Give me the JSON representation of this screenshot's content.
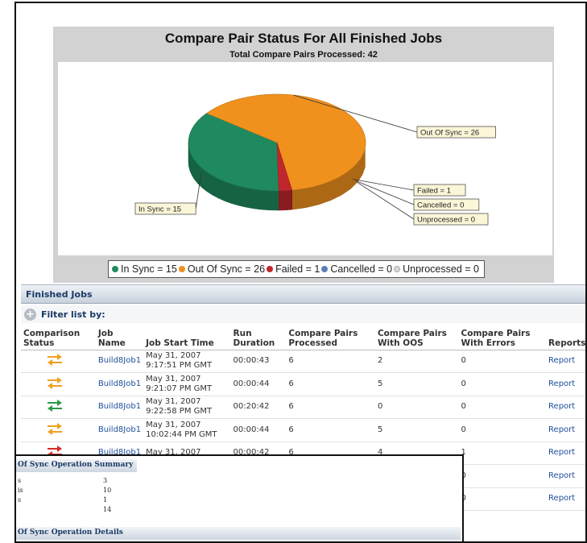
{
  "chart": {
    "title": "Compare Pair Status For All Finished Jobs",
    "subtitle": "Total Compare Pairs Processed: 42"
  },
  "chart_data": {
    "type": "pie",
    "title": "Compare Pair Status For All Finished Jobs",
    "subtitle": "Total Compare Pairs Processed: 42",
    "categories": [
      "In Sync",
      "Out Of Sync",
      "Failed",
      "Cancelled",
      "Unprocessed"
    ],
    "values": [
      15,
      26,
      1,
      0,
      0
    ],
    "colors": [
      "#1f8a5f",
      "#f0911e",
      "#c0272d",
      "#5b7fb5",
      "#d8d8d8"
    ],
    "slice_labels": [
      "In Sync = 15",
      "Out Of Sync = 26",
      "Failed = 1",
      "Cancelled = 0",
      "Unprocessed = 0"
    ],
    "legend": [
      "In Sync = 15",
      "Out Of Sync = 26",
      "Failed = 1",
      "Cancelled = 0",
      "Unprocessed = 0"
    ],
    "legend_position": "bottom",
    "style": "3d"
  },
  "finished_jobs": {
    "section_title": "Finished Jobs",
    "filter_label": "Filter list by:",
    "filter_icon": "add-filter-icon",
    "columns": [
      "Comparison Status",
      "Job Name",
      "Job Start Time",
      "Run Duration",
      "Compare Pairs Processed",
      "Compare Pairs With OOS",
      "Compare Pairs With Errors",
      "Reports"
    ],
    "rows": [
      {
        "status": "out-of-sync",
        "status_color": "#f0a020",
        "job_name": "Build8Job1",
        "start_date": "May 31, 2007",
        "start_time": "9:17:51 PM GMT",
        "duration": "00:00:43",
        "processed": "6",
        "oos": "2",
        "errors": "0",
        "report": "Report"
      },
      {
        "status": "out-of-sync",
        "status_color": "#f0a020",
        "job_name": "Build8Job1",
        "start_date": "May 31, 2007",
        "start_time": "9:21:07 PM GMT",
        "duration": "00:00:44",
        "processed": "6",
        "oos": "5",
        "errors": "0",
        "report": "Report"
      },
      {
        "status": "in-sync",
        "status_color": "#2a9a4a",
        "job_name": "Build8Job1",
        "start_date": "May 31, 2007",
        "start_time": "9:22:58 PM GMT",
        "duration": "00:20:42",
        "processed": "6",
        "oos": "0",
        "errors": "0",
        "report": "Report"
      },
      {
        "status": "out-of-sync",
        "status_color": "#f0a020",
        "job_name": "Build8Job1",
        "start_date": "May 31, 2007",
        "start_time": "10:02:44 PM GMT",
        "duration": "00:00:44",
        "processed": "6",
        "oos": "5",
        "errors": "0",
        "report": "Report"
      },
      {
        "status": "error",
        "status_color": "#d62a2a",
        "job_name": "Build8Job1",
        "start_date": "May 31, 2007",
        "start_time": "",
        "duration": "00:00:42",
        "processed": "6",
        "oos": "4",
        "errors": "1",
        "report": "Report"
      },
      {
        "status": "",
        "status_color": "",
        "job_name": "",
        "start_date": "",
        "start_time": "",
        "duration": "",
        "processed": "",
        "oos": "",
        "errors": "0",
        "report": "Report"
      },
      {
        "status": "",
        "status_color": "",
        "job_name": "",
        "start_date": "",
        "start_time": "",
        "duration": "",
        "processed": "",
        "oos": "",
        "errors": "0",
        "report": "Report"
      }
    ]
  },
  "overlay": {
    "summary_title": "Of Sync Operation Summary",
    "summary_rows": [
      {
        "label": "s",
        "value": "3"
      },
      {
        "label": "is",
        "value": "10"
      },
      {
        "label": "s",
        "value": "1"
      },
      {
        "label": "",
        "value": "14"
      }
    ],
    "details_title": "Of Sync Operation Details"
  }
}
